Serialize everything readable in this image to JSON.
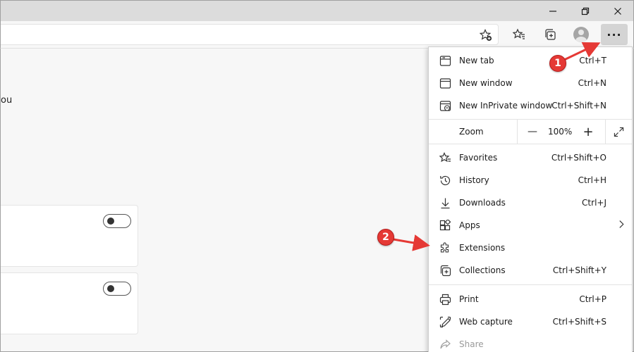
{
  "toolbar": {
    "more_label": "···"
  },
  "page": {
    "partial_text": "ou"
  },
  "menu": {
    "items": [
      {
        "label": "New tab",
        "shortcut": "Ctrl+T",
        "icon": "new-tab-icon"
      },
      {
        "label": "New window",
        "shortcut": "Ctrl+N",
        "icon": "new-window-icon"
      },
      {
        "label": "New InPrivate window",
        "shortcut": "Ctrl+Shift+N",
        "icon": "inprivate-icon"
      },
      {
        "label": "Favorites",
        "shortcut": "Ctrl+Shift+O",
        "icon": "star-icon"
      },
      {
        "label": "History",
        "shortcut": "Ctrl+H",
        "icon": "history-icon"
      },
      {
        "label": "Downloads",
        "shortcut": "Ctrl+J",
        "icon": "download-icon"
      },
      {
        "label": "Apps",
        "shortcut": "",
        "icon": "apps-icon"
      },
      {
        "label": "Extensions",
        "shortcut": "",
        "icon": "puzzle-icon"
      },
      {
        "label": "Collections",
        "shortcut": "Ctrl+Shift+Y",
        "icon": "collections-icon"
      },
      {
        "label": "Print",
        "shortcut": "Ctrl+P",
        "icon": "printer-icon"
      },
      {
        "label": "Web capture",
        "shortcut": "Ctrl+Shift+S",
        "icon": "web-capture-icon"
      },
      {
        "label": "Share",
        "shortcut": "",
        "icon": "share-icon"
      }
    ],
    "zoom": {
      "label": "Zoom",
      "value": "100%",
      "minus": "—",
      "plus": "+"
    }
  },
  "annotations": {
    "badge1": "1",
    "badge2": "2",
    "color": "#e53935"
  }
}
